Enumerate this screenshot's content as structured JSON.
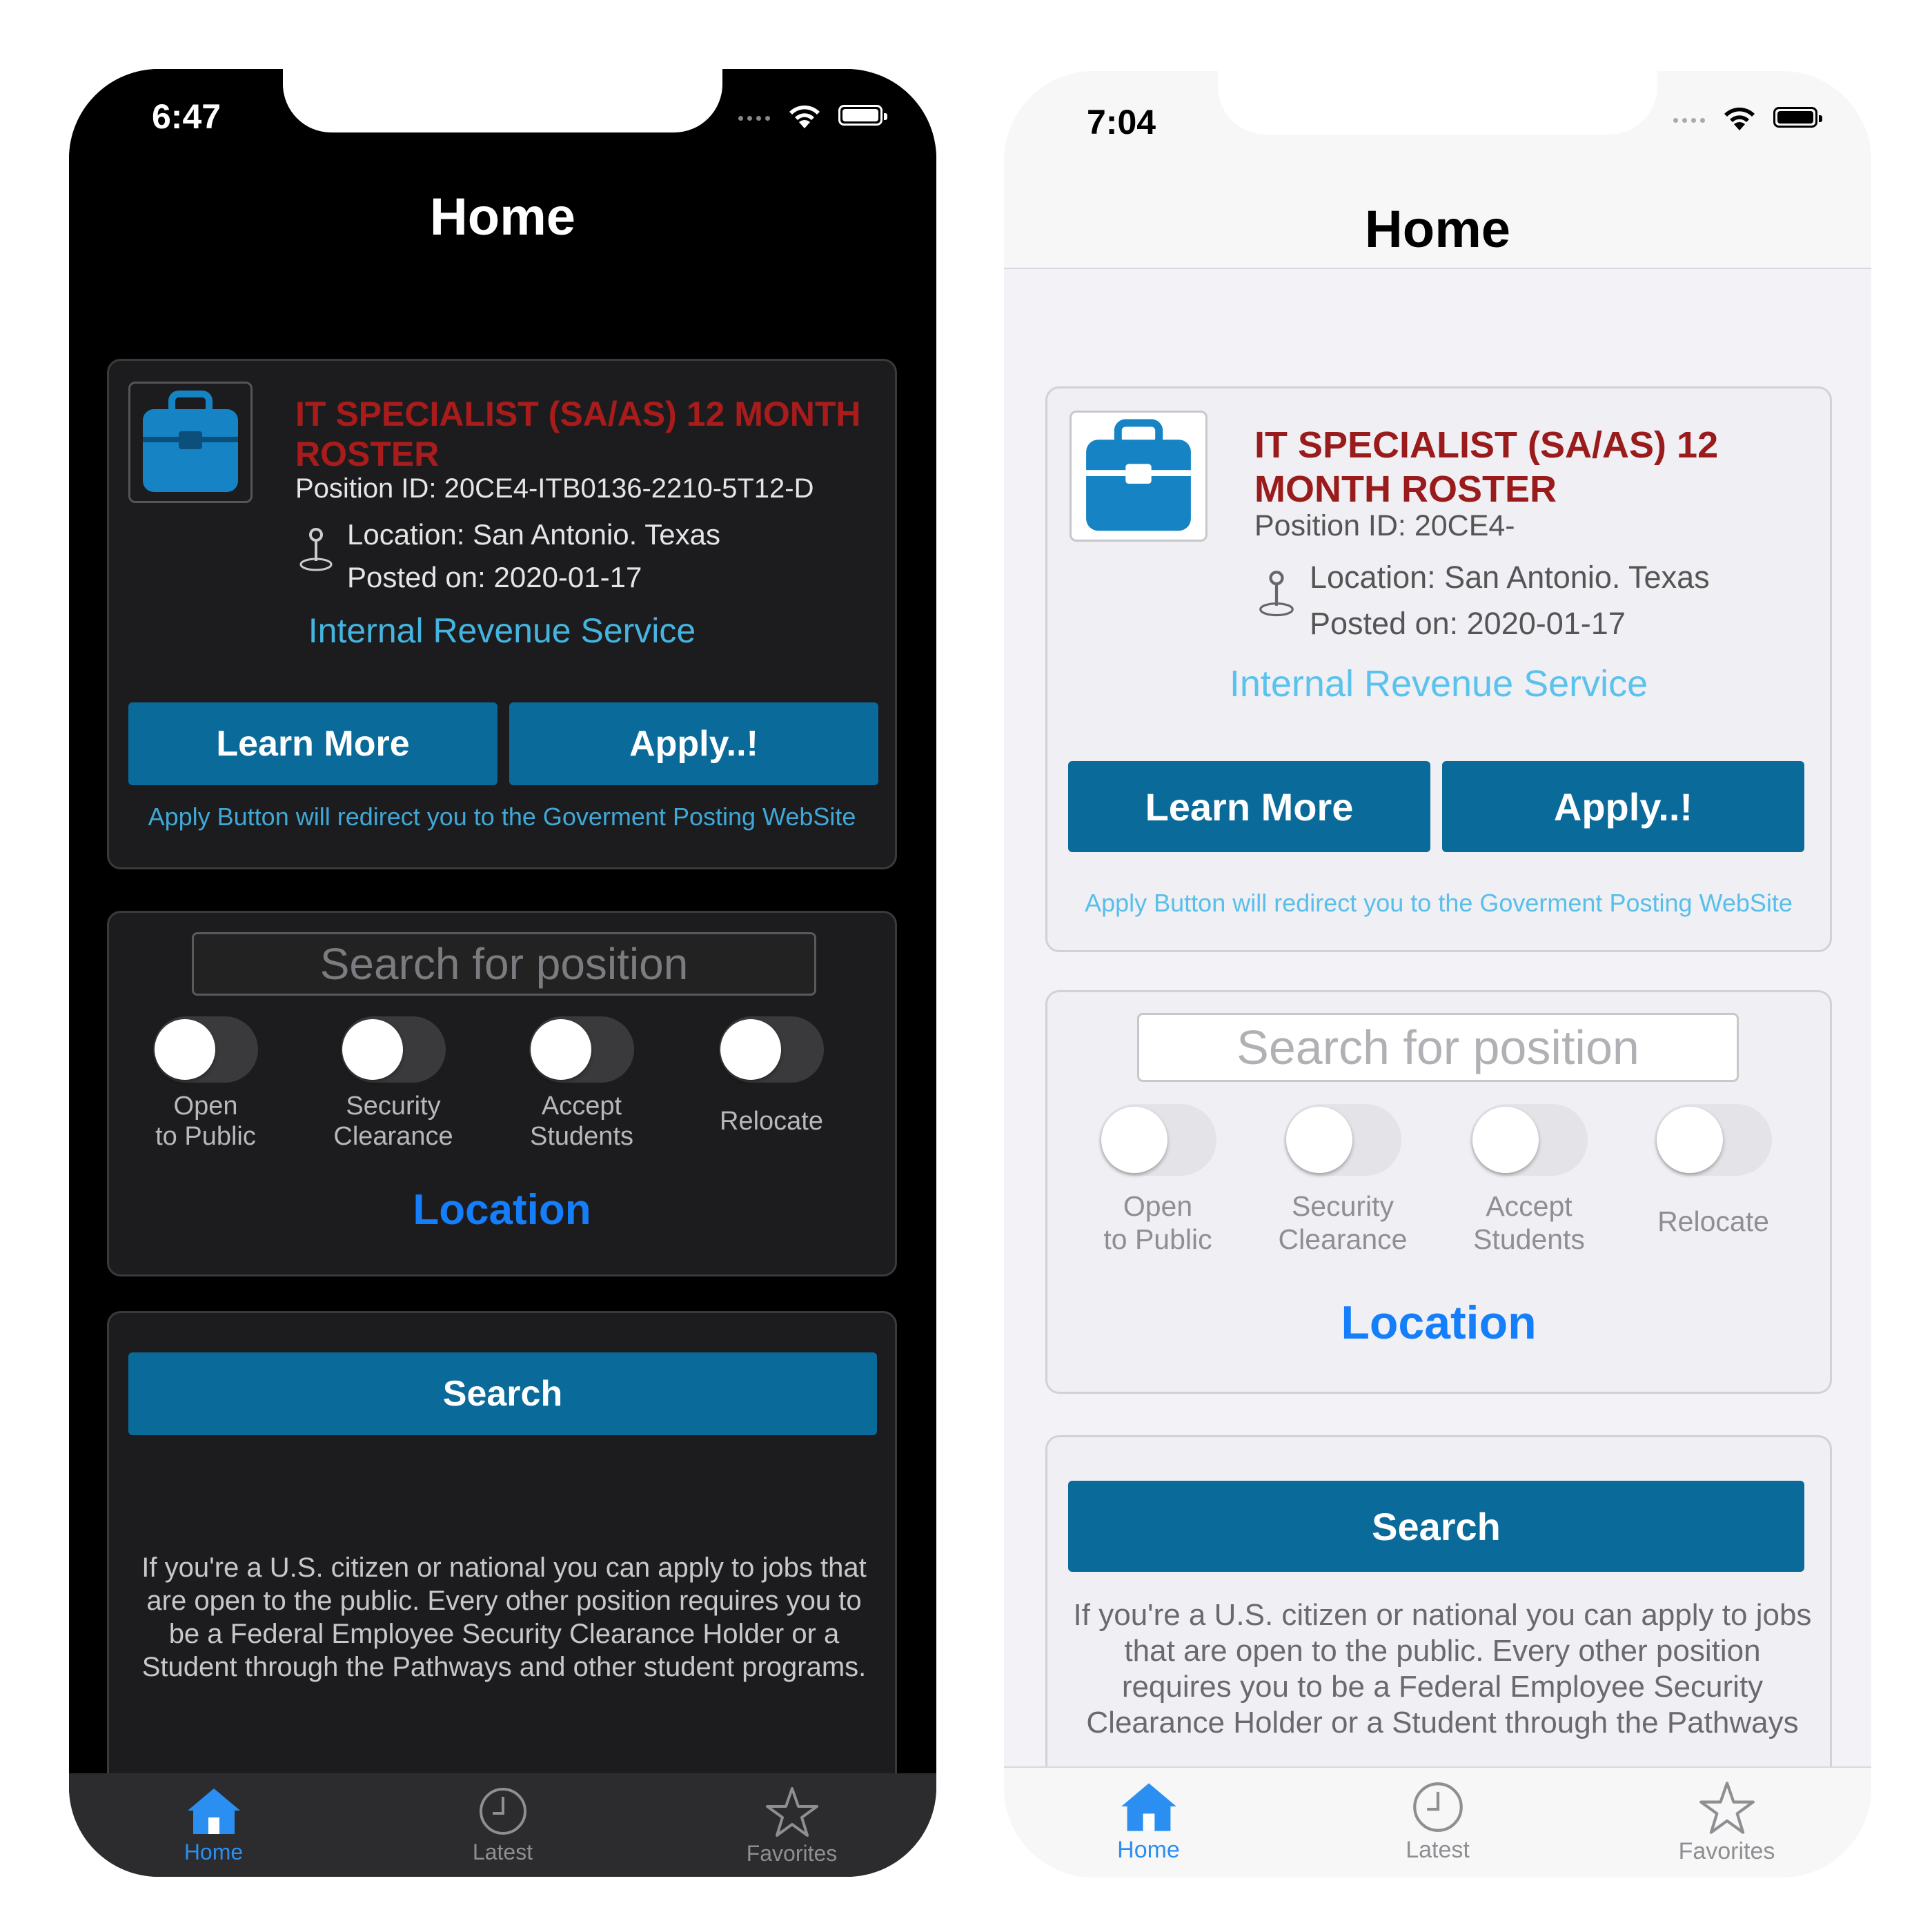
{
  "screens": {
    "dark": {
      "time": "6:47",
      "title": "Home",
      "job": {
        "title": "IT SPECIALIST (SA/AS) 12 MONTH ROSTER",
        "position_id": "Position ID: 20CE4-ITB0136-2210-5T12-D",
        "location": "Location: San Antonio. Texas",
        "posted": "Posted on: 2020-01-17",
        "agency": "Internal Revenue Service",
        "learn_more": "Learn More",
        "apply": "Apply..!",
        "note": "Apply Button will redirect you to the Goverment Posting WebSite"
      },
      "filters": {
        "search_placeholder": "Search for position",
        "toggles": [
          {
            "line1": "Open",
            "line2": "to Public",
            "on": false
          },
          {
            "line1": "Security",
            "line2": "Clearance",
            "on": false
          },
          {
            "line1": "Accept",
            "line2": "Students",
            "on": false
          },
          {
            "line1": "Relocate",
            "line2": "",
            "on": false
          }
        ],
        "location_label": "Location"
      },
      "search_button": "Search",
      "info": "If you're a U.S. citizen or national you can apply to jobs that are open to the public. Every other position requires you to be a Federal Employee Security Clearance Holder or a Student through the Pathways and other student programs.",
      "tabs": [
        {
          "label": "Home",
          "icon": "home-icon",
          "active": true
        },
        {
          "label": "Latest",
          "icon": "clock-icon",
          "active": false
        },
        {
          "label": "Favorites",
          "icon": "star-icon",
          "active": false
        }
      ]
    },
    "light": {
      "time": "7:04",
      "title": "Home",
      "job": {
        "title": "IT SPECIALIST (SA/AS) 12 MONTH ROSTER",
        "position_id": "Position ID: 20CE4-",
        "location": "Location: San Antonio. Texas",
        "posted": "Posted on: 2020-01-17",
        "agency": "Internal Revenue Service",
        "learn_more": "Learn More",
        "apply": "Apply..!",
        "note": "Apply Button will redirect you to the Goverment Posting WebSite"
      },
      "filters": {
        "search_placeholder": "Search for position",
        "toggles": [
          {
            "line1": "Open",
            "line2": "to Public",
            "on": false
          },
          {
            "line1": "Security",
            "line2": "Clearance",
            "on": false
          },
          {
            "line1": "Accept",
            "line2": "Students",
            "on": false
          },
          {
            "line1": "Relocate",
            "line2": "",
            "on": false
          }
        ],
        "location_label": "Location"
      },
      "search_button": "Search",
      "info": "If you're a U.S. citizen or national you can apply to jobs that are open to the public. Every other position requires you to be a Federal Employee Security Clearance Holder or a Student through the Pathways",
      "tabs": [
        {
          "label": "Home",
          "icon": "home-icon",
          "active": true
        },
        {
          "label": "Latest",
          "icon": "clock-icon",
          "active": false
        },
        {
          "label": "Favorites",
          "icon": "star-icon",
          "active": false
        }
      ]
    }
  },
  "colors": {
    "button": "#0a6a9a",
    "job_title_red": "#a81c1c",
    "agency_link": "#44b5e0",
    "location_blue": "#147efb",
    "tab_active": "#2a8ff0"
  }
}
